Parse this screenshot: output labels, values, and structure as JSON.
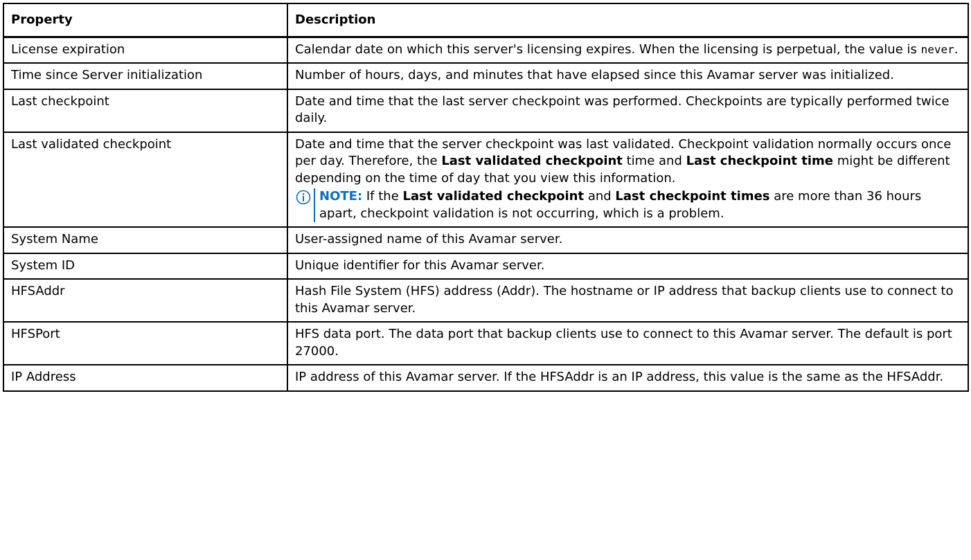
{
  "headers": {
    "property": "Property",
    "description": "Description"
  },
  "rows": [
    {
      "property": "License expiration",
      "desc_before": "Calendar date on which this server's licensing expires. When the licensing is perpetual, the value is ",
      "desc_code": "never",
      "desc_after": "."
    },
    {
      "property": "Time since Server initialization",
      "description": "Number of hours, days, and minutes that have elapsed since this Avamar server was initialized."
    },
    {
      "property": "Last checkpoint",
      "description": "Date and time that the last server checkpoint was performed. Checkpoints are typically performed twice daily."
    },
    {
      "property": "Last validated checkpoint",
      "desc_p1": "Date and time that the server checkpoint was last validated. Checkpoint validation normally occurs once per day. Therefore, the ",
      "desc_b1": "Last validated checkpoint",
      "desc_p2": " time and ",
      "desc_b2": "Last checkpoint time",
      "desc_p3": " might be different depending on the time of day that you view this information.",
      "note_label": "NOTE:",
      "note_p1": " If the ",
      "note_b1": "Last validated checkpoint",
      "note_p2": " and ",
      "note_b2": "Last checkpoint times",
      "note_p3": " are more than 36 hours apart, checkpoint validation is not occurring, which is a problem."
    },
    {
      "property": "System Name",
      "description": "User-assigned name of this Avamar server."
    },
    {
      "property": "System ID",
      "description": "Unique identifier for this Avamar server."
    },
    {
      "property": "HFSAddr",
      "description": "Hash File System (HFS) address (Addr). The hostname or IP address that backup clients use to connect to this Avamar server."
    },
    {
      "property": "HFSPort",
      "description": "HFS data port. The data port that backup clients use to connect to this Avamar server. The default is port 27000."
    },
    {
      "property": "IP Address",
      "description": "IP address of this Avamar server. If the HFSAddr is an IP address, this value is the same as the HFSAddr."
    }
  ],
  "note_icon": "info-icon",
  "accent_color": "#0b6ebf"
}
